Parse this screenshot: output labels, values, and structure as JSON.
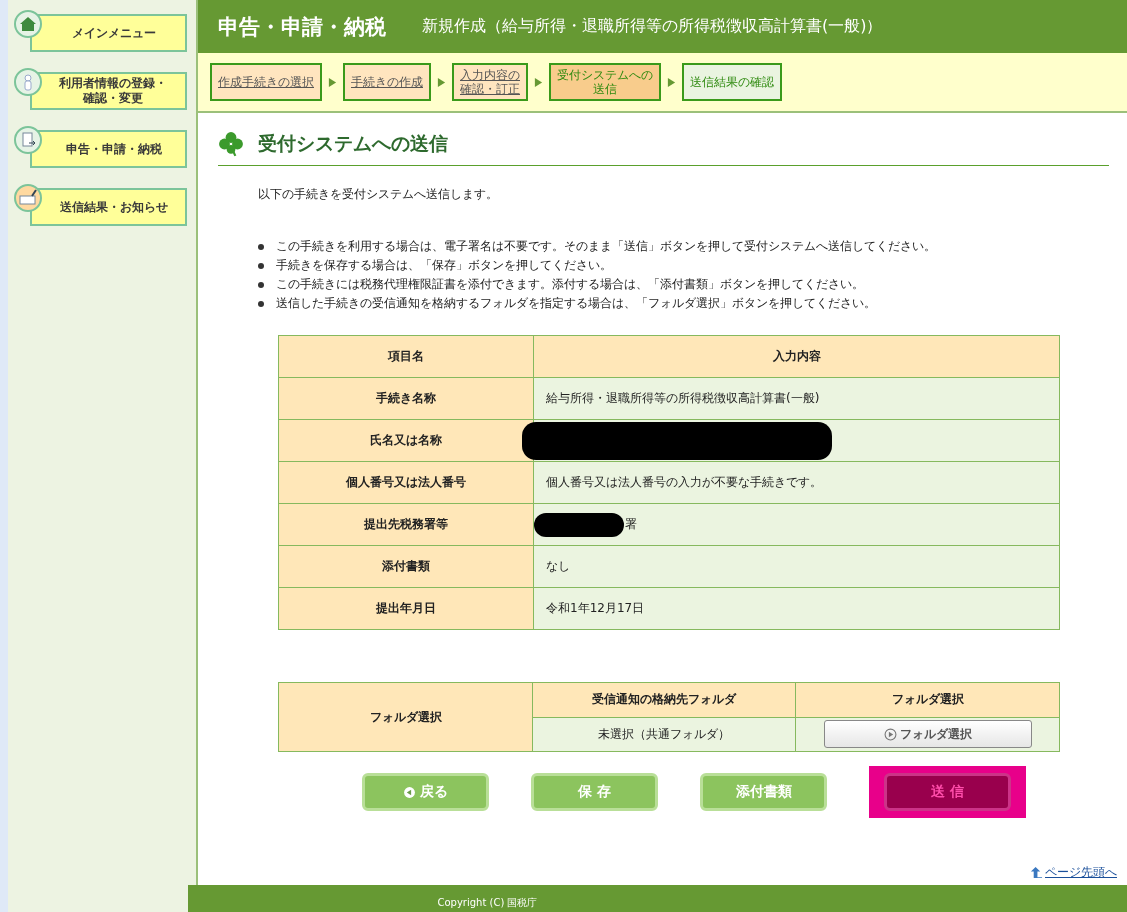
{
  "sidebar": {
    "items": [
      {
        "label": "メインメニュー"
      },
      {
        "label": "利用者情報の登録・確認・変更"
      },
      {
        "label": "申告・申請・納税"
      },
      {
        "label": "送信結果・お知らせ"
      }
    ]
  },
  "header": {
    "title": "申告・申請・納税",
    "subtitle": "新規作成（給与所得・退職所得等の所得税徴収高計算書(一般)）"
  },
  "steps": [
    {
      "label": "作成手続きの選択",
      "kind": "done"
    },
    {
      "label": "手続きの作成",
      "kind": "done"
    },
    {
      "label": "入力内容の確認・訂正",
      "kind": "done"
    },
    {
      "label": "受付システムへの送信",
      "kind": "current"
    },
    {
      "label": "送信結果の確認",
      "kind": "pending"
    }
  ],
  "section_title": "受付システムへの送信",
  "intro": "以下の手続きを受付システムへ送信します。",
  "notes": [
    "この手続きを利用する場合は、電子署名は不要です。そのまま「送信」ボタンを押して受付システムへ送信してください。",
    "手続きを保存する場合は、「保存」ボタンを押してください。",
    "この手続きには税務代理権限証書を添付できます。添付する場合は、「添付書類」ボタンを押してください。",
    "送信した手続きの受信通知を格納するフォルダを指定する場合は、「フォルダ選択」ボタンを押してください。"
  ],
  "table": {
    "columns": [
      "項目名",
      "入力内容"
    ],
    "rows": [
      {
        "label": "手続き名称",
        "value": "給与所得・退職所得等の所得税徴収高計算書(一般)",
        "redacted": false
      },
      {
        "label": "氏名又は名称",
        "redacted": true
      },
      {
        "label": "個人番号又は法人番号",
        "value": "個人番号又は法人番号の入力が不要な手続きです。",
        "redacted": false
      },
      {
        "label": "提出先税務署等",
        "value": "署",
        "redacted": true
      },
      {
        "label": "添付書類",
        "value": "なし",
        "redacted": false
      },
      {
        "label": "提出年月日",
        "value": "令和1年12月17日",
        "redacted": false
      }
    ]
  },
  "folder": {
    "label": "フォルダ選択",
    "columns": [
      "受信通知の格納先フォルダ",
      "フォルダ選択"
    ],
    "value": "未選択（共通フォルダ）",
    "button": "フォルダ選択"
  },
  "buttons": [
    {
      "label": "戻る",
      "kind": "back"
    },
    {
      "label": "保 存",
      "kind": "normal"
    },
    {
      "label": "添付書類",
      "kind": "normal"
    },
    {
      "label": "送 信",
      "kind": "send"
    }
  ],
  "page_top_link": "ページ先頭へ",
  "footer": "Copyright (C) 国税庁"
}
